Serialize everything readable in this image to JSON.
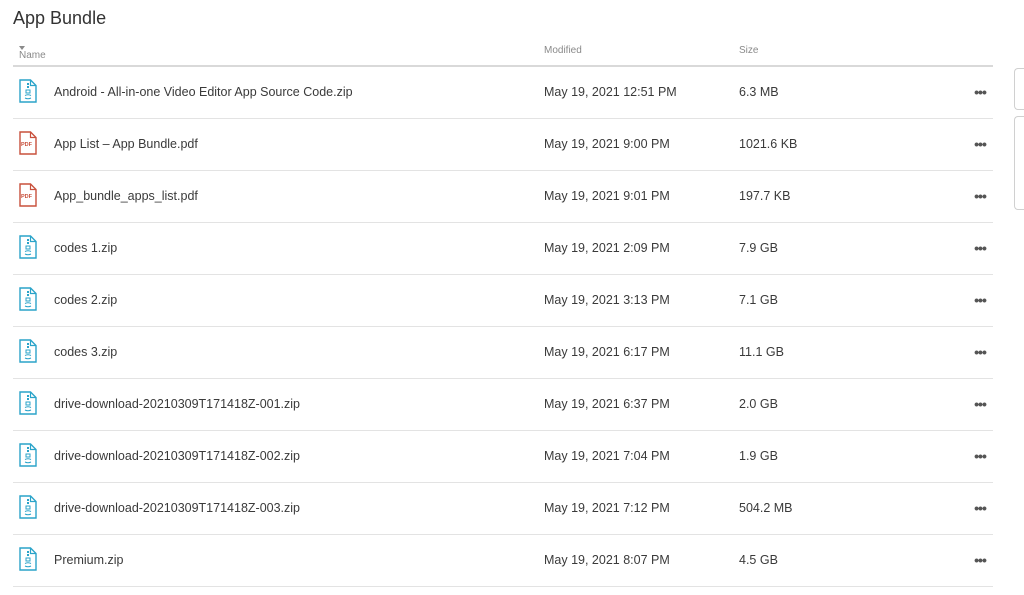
{
  "page": {
    "title": "App Bundle"
  },
  "columns": {
    "name": "Name",
    "modified": "Modified",
    "size": "Size"
  },
  "files": [
    {
      "name": "Android - All-in-one Video Editor App Source Code.zip",
      "modified": "May 19, 2021 12:51 PM",
      "size": "6.3 MB",
      "icon": "zip-file-icon"
    },
    {
      "name": "App List – App Bundle.pdf",
      "modified": "May 19, 2021 9:00 PM",
      "size": "1021.6 KB",
      "icon": "pdf-file-icon",
      "badge": "PDF"
    },
    {
      "name": "App_bundle_apps_list.pdf",
      "modified": "May 19, 2021 9:01 PM",
      "size": "197.7 KB",
      "icon": "pdf-file-icon",
      "badge": "PDF"
    },
    {
      "name": "codes 1.zip",
      "modified": "May 19, 2021 2:09 PM",
      "size": "7.9 GB",
      "icon": "zip-file-icon"
    },
    {
      "name": "codes 2.zip",
      "modified": "May 19, 2021 3:13 PM",
      "size": "7.1 GB",
      "icon": "zip-file-icon"
    },
    {
      "name": "codes 3.zip",
      "modified": "May 19, 2021 6:17 PM",
      "size": "11.1 GB",
      "icon": "zip-file-icon"
    },
    {
      "name": "drive-download-20210309T171418Z-001.zip",
      "modified": "May 19, 2021 6:37 PM",
      "size": "2.0 GB",
      "icon": "zip-file-icon"
    },
    {
      "name": "drive-download-20210309T171418Z-002.zip",
      "modified": "May 19, 2021 7:04 PM",
      "size": "1.9 GB",
      "icon": "zip-file-icon"
    },
    {
      "name": "drive-download-20210309T171418Z-003.zip",
      "modified": "May 19, 2021 7:12 PM",
      "size": "504.2 MB",
      "icon": "zip-file-icon"
    },
    {
      "name": "Premium.zip",
      "modified": "May 19, 2021 8:07 PM",
      "size": "4.5 GB",
      "icon": "zip-file-icon"
    }
  ],
  "more_label": "•••",
  "colors": {
    "zip": "#2aa3c9",
    "pdf": "#c8503c",
    "border": "#e3e3e3"
  }
}
